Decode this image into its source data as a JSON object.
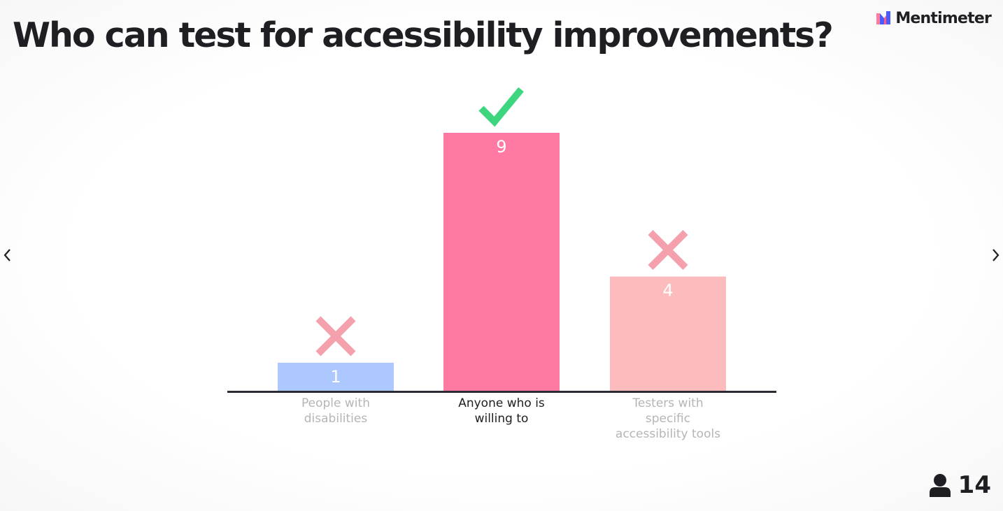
{
  "slide": {
    "title": "Who can test for accessibility improvements?"
  },
  "brand": {
    "name": "Mentimeter",
    "logo_colors": [
      "#ff7da1",
      "#4a5cff",
      "#ff5a80"
    ]
  },
  "navigation": {
    "prev_icon": "chevron-left-icon",
    "next_icon": "chevron-right-icon"
  },
  "participants": {
    "icon": "person-icon",
    "count": "14"
  },
  "colors": {
    "correct_mark": "#3dd67f",
    "incorrect_mark": "#f4a0ad",
    "axis": "#2b2b33",
    "label_muted": "#b5b5b8",
    "label_active": "#1f1f23"
  },
  "chart_data": {
    "type": "bar",
    "categories": [
      "People with disabilities",
      "Anyone who is willing to",
      "Testers with specific accessibility tools"
    ],
    "label_lines": [
      [
        "People with",
        "disabilities"
      ],
      [
        "Anyone who is",
        "willing to"
      ],
      [
        "Testers with",
        "specific",
        "accessibility tools"
      ]
    ],
    "values": [
      1,
      9,
      4
    ],
    "value_labels": [
      "1",
      "9",
      "4"
    ],
    "correct": [
      false,
      true,
      false
    ],
    "bar_colors": [
      "#adc7ff",
      "#ff7aa3",
      "#fcbcbd"
    ],
    "ylim": [
      0,
      9
    ]
  }
}
